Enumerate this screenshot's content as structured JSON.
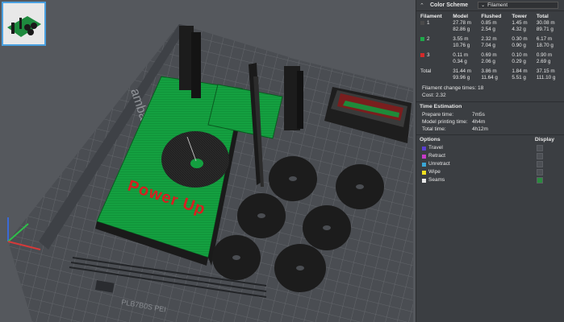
{
  "viewport": {
    "plate_label": "amba Textured PEI Plate",
    "model_text": "Power Up",
    "plate_code": "PLB7B0S PEI"
  },
  "panel": {
    "title": "Color Scheme",
    "scheme_value": "Filament",
    "table": {
      "headers": [
        "Filament",
        "Model",
        "Flushed",
        "Tower",
        "Total"
      ],
      "rows": [
        {
          "id": "1",
          "color": "#4a4a4a",
          "model": [
            "27.78 m",
            "82.86 g"
          ],
          "flushed": [
            "0.85 m",
            "2.54 g"
          ],
          "tower": [
            "1.45 m",
            "4.32 g"
          ],
          "total": [
            "30.08 m",
            "89.71 g"
          ]
        },
        {
          "id": "2",
          "color": "#1fa84a",
          "model": [
            "3.55 m",
            "10.76 g"
          ],
          "flushed": [
            "2.32 m",
            "7.04 g"
          ],
          "tower": [
            "0.30 m",
            "0.90 g"
          ],
          "total": [
            "6.17 m",
            "18.70 g"
          ]
        },
        {
          "id": "3",
          "color": "#d42a2a",
          "model": [
            "0.11 m",
            "0.34 g"
          ],
          "flushed": [
            "0.69 m",
            "2.06 g"
          ],
          "tower": [
            "0.10 m",
            "0.29 g"
          ],
          "total": [
            "0.90 m",
            "2.69 g"
          ]
        }
      ],
      "total": {
        "label": "Total",
        "model": [
          "31.44 m",
          "93.96 g"
        ],
        "flushed": [
          "3.86 m",
          "11.64 g"
        ],
        "tower": [
          "1.84 m",
          "5.51 g"
        ],
        "total": [
          "37.15 m",
          "111.10 g"
        ]
      }
    },
    "change_times_label": "Filament change times:",
    "change_times_value": "18",
    "cost_label": "Cost:",
    "cost_value": "2.32",
    "time_section": "Time Estimation",
    "prepare_label": "Prepare time:",
    "prepare_value": "7m5s",
    "printing_label": "Model printing time:",
    "printing_value": "4h4m",
    "total_label": "Total time:",
    "total_value": "4h12m",
    "options_label": "Options",
    "display_label": "Display",
    "options": [
      {
        "name": "Travel",
        "color": "#5a3fd0",
        "checked": false
      },
      {
        "name": "Retract",
        "color": "#c83ac8",
        "checked": false
      },
      {
        "name": "Unretract",
        "color": "#3aa6d6",
        "checked": false
      },
      {
        "name": "Wipe",
        "color": "#f0e020",
        "checked": false
      },
      {
        "name": "Seams",
        "color": "#e8e8e8",
        "checked": true
      }
    ]
  }
}
